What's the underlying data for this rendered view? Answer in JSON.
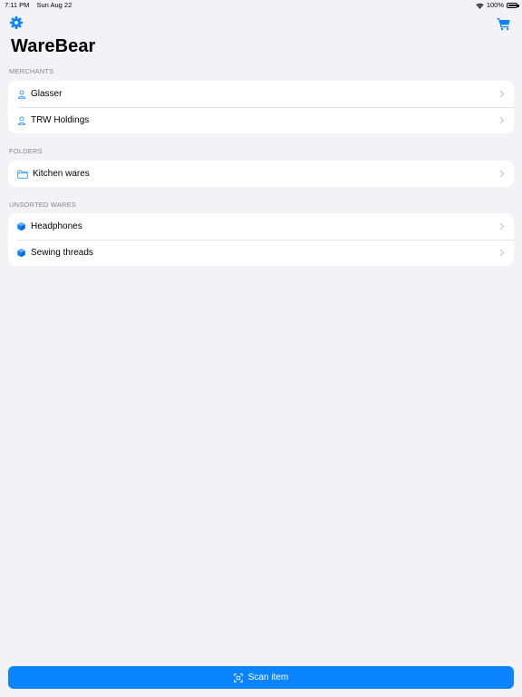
{
  "status_bar": {
    "time": "7:11 PM",
    "date": "Sun Aug 22",
    "battery": "100%"
  },
  "header": {
    "title": "WareBear",
    "settings_icon": "gear-icon",
    "cart_icon": "cart-icon"
  },
  "sections": {
    "merchants": {
      "header": "MERCHANTS",
      "items": [
        {
          "label": "Glasser",
          "icon": "person-icon"
        },
        {
          "label": "TRW Holdings",
          "icon": "person-icon"
        }
      ]
    },
    "folders": {
      "header": "FOLDERS",
      "items": [
        {
          "label": "Kitchen wares",
          "icon": "folder-icon"
        }
      ]
    },
    "unsorted": {
      "header": "UNSORTED WARES",
      "items": [
        {
          "label": "Headphones",
          "icon": "cube-icon"
        },
        {
          "label": "Sewing threads",
          "icon": "cube-icon"
        }
      ]
    }
  },
  "footer": {
    "scan_label": "Scan item",
    "scan_icon": "viewfinder-icon"
  },
  "colors": {
    "accent": "#0a84ff",
    "background": "#f2f2f7",
    "secondary_text": "#86868b"
  }
}
